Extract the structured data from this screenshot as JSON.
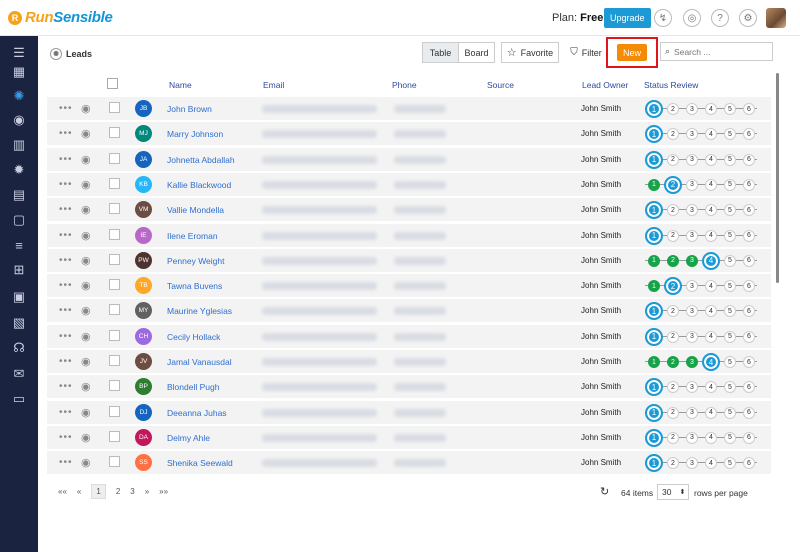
{
  "app": {
    "logo_run": "Run",
    "logo_sensible": "Sensible",
    "logo_mark": "R"
  },
  "header": {
    "plan_label": "Plan:",
    "plan_value": "Free",
    "upgrade_label": "Upgrade"
  },
  "toolbar": {
    "title": "Leads",
    "view_table": "Table",
    "view_board": "Board",
    "favorite_label": "Favorite",
    "filter_label": "Filter",
    "new_label": "New",
    "search_placeholder": "Search ..."
  },
  "table": {
    "columns": [
      "Name",
      "Email",
      "Phone",
      "Source",
      "Lead Owner",
      "Status Review"
    ],
    "stage_labels": [
      "1",
      "2",
      "3",
      "4",
      "5",
      "6"
    ],
    "rows": [
      {
        "initials": "JB",
        "name": "John Brown",
        "owner": "John Smith",
        "stage": 1,
        "color": "#1565c0"
      },
      {
        "initials": "MJ",
        "name": "Marry Johnson",
        "owner": "John Smith",
        "stage": 1,
        "color": "#00897b"
      },
      {
        "initials": "JA",
        "name": "Johnetta Abdallah",
        "owner": "John Smith",
        "stage": 1,
        "color": "#1565c0"
      },
      {
        "initials": "KB",
        "name": "Kallie Blackwood",
        "owner": "John Smith",
        "stage": 2,
        "color": "#29b6f6"
      },
      {
        "initials": "VM",
        "name": "Vallie Mondella",
        "owner": "John Smith",
        "stage": 1,
        "color": "#6d4c41"
      },
      {
        "initials": "IE",
        "name": "Ilene Eroman",
        "owner": "John Smith",
        "stage": 1,
        "color": "#ba68c8"
      },
      {
        "initials": "PW",
        "name": "Penney Weight",
        "owner": "John Smith",
        "stage": 4,
        "color": "#4e342e"
      },
      {
        "initials": "TB",
        "name": "Tawna Buvens",
        "owner": "John Smith",
        "stage": 2,
        "color": "#ffa726"
      },
      {
        "initials": "MY",
        "name": "Maurine Yglesias",
        "owner": "John Smith",
        "stage": 1,
        "color": "#616161"
      },
      {
        "initials": "CH",
        "name": "Cecily Hollack",
        "owner": "John Smith",
        "stage": 1,
        "color": "#9c6ade"
      },
      {
        "initials": "JV",
        "name": "Jamal Vanausdal",
        "owner": "John Smith",
        "stage": 4,
        "color": "#6d4c41"
      },
      {
        "initials": "BP",
        "name": "Blondell Pugh",
        "owner": "John Smith",
        "stage": 1,
        "color": "#2e7d32"
      },
      {
        "initials": "DJ",
        "name": "Deeanna Juhas",
        "owner": "John Smith",
        "stage": 1,
        "color": "#1565c0"
      },
      {
        "initials": "DA",
        "name": "Delmy Ahle",
        "owner": "John Smith",
        "stage": 1,
        "color": "#c2185b"
      },
      {
        "initials": "SS",
        "name": "Shenika Seewald",
        "owner": "John Smith",
        "stage": 1,
        "color": "#ff7043"
      }
    ]
  },
  "pagination": {
    "first": "««",
    "prev": "«",
    "pages": [
      "1",
      "2",
      "3"
    ],
    "next": "»",
    "last": "»»",
    "items_text": "64 items",
    "rows_per_page_value": "30",
    "rows_per_page_label": "rows per page"
  },
  "sidebar_icons": [
    "menu-icon",
    "dashboard-icon",
    "leads-icon",
    "contacts-icon",
    "companies-icon",
    "ideas-icon",
    "documents-icon",
    "notes-icon",
    "tasks-icon",
    "org-chart-icon",
    "calendar-icon",
    "reports-icon",
    "support-icon",
    "mail-icon",
    "folder-icon"
  ]
}
